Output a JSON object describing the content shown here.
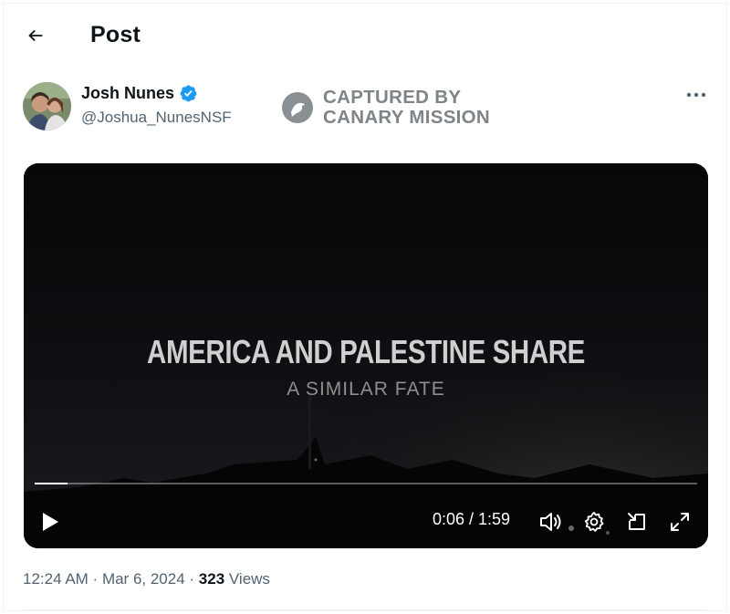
{
  "header": {
    "title": "Post"
  },
  "author": {
    "name": "Josh Nunes",
    "handle": "@Joshua_NunesNSF",
    "verified": true
  },
  "watermark": {
    "line1": "CAPTURED BY",
    "line2": "CANARY MISSION"
  },
  "video": {
    "title": "AMERICA AND PALESTINE SHARE",
    "subtitle": "A SIMILAR FATE",
    "time_display": "0:06 / 1:59",
    "progress_fraction": 0.05
  },
  "meta": {
    "time": "12:24 AM",
    "separator": " · ",
    "date": "Mar 6, 2024",
    "views_count": "323",
    "views_label": "Views"
  },
  "colors": {
    "verified_badge": "#1d9bf0",
    "secondary_text": "#536471",
    "primary_text": "#0f1419"
  }
}
